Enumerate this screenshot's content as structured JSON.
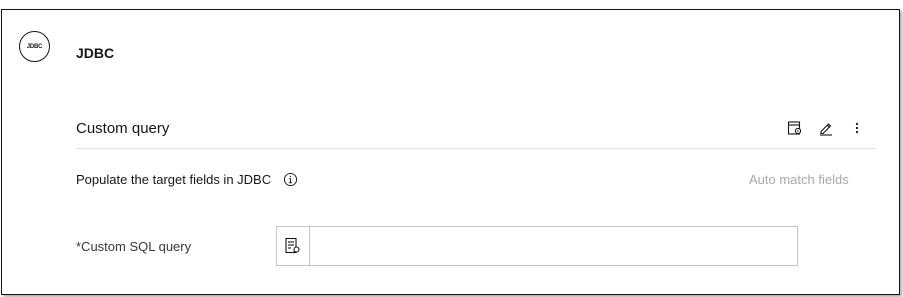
{
  "connector": {
    "logo_text": "JDBC",
    "title": "JDBC"
  },
  "section": {
    "title": "Custom query",
    "icons": [
      "query-preview-icon",
      "edit-icon",
      "overflow-menu-icon"
    ]
  },
  "mapping": {
    "label": "Populate the target fields in JDBC",
    "info_icon": "info-icon",
    "auto_match_label": "Auto match fields"
  },
  "query_field": {
    "label": "*Custom SQL query",
    "value": "",
    "icon": "query-builder-icon"
  }
}
